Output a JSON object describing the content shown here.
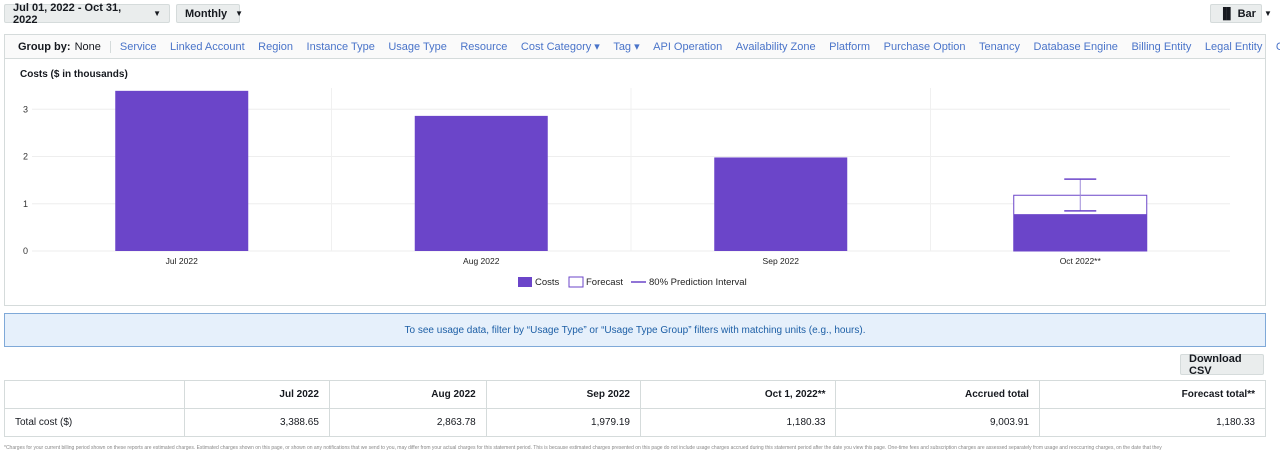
{
  "toolbar": {
    "date_range": "Jul 01, 2022 - Oct 31, 2022",
    "granularity": "Monthly",
    "chart_type": "Bar"
  },
  "group_by": {
    "label": "Group by:",
    "selected": "None",
    "options": [
      "Service",
      "Linked Account",
      "Region",
      "Instance Type",
      "Usage Type",
      "Resource",
      "Cost Category ▾",
      "Tag ▾",
      "API Operation",
      "Availability Zone",
      "Platform",
      "Purchase Option",
      "Tenancy",
      "Database Engine",
      "Billing Entity",
      "Legal Entity",
      "Charge Type"
    ]
  },
  "chart_data": {
    "type": "bar",
    "title": "Costs ($ in thousands)",
    "xlabel": "",
    "ylabel": "",
    "categories": [
      "Jul 2022",
      "Aug 2022",
      "Sep 2022",
      "Oct 2022**"
    ],
    "yticks": [
      0,
      1,
      2,
      3
    ],
    "ylim": [
      0,
      3.45
    ],
    "grid": true,
    "legend_position": "bottom",
    "series": [
      {
        "name": "Costs",
        "values": [
          3.39,
          2.86,
          1.98,
          0.78
        ],
        "color": "#6b45c9"
      },
      {
        "name": "Forecast",
        "values": [
          null,
          null,
          null,
          1.18
        ],
        "color": "#ffffff",
        "stroke": "#6b45c9"
      }
    ],
    "prediction_interval": {
      "name": "80% Prediction Interval",
      "category": "Oct 2022**",
      "low": 0.85,
      "high": 1.52,
      "color": "#6b45c9"
    }
  },
  "banner": "To see usage data, filter by “Usage Type” or “Usage Type Group” filters with matching units (e.g., hours).",
  "download_label": "Download CSV",
  "table": {
    "headers": [
      "",
      "Jul 2022",
      "Aug 2022",
      "Sep 2022",
      "Oct 1, 2022**",
      "Accrued total",
      "Forecast total**"
    ],
    "rows": [
      [
        "Total cost ($)",
        "3,388.65",
        "2,863.78",
        "1,979.19",
        "1,180.33",
        "9,003.91",
        "1,180.33"
      ]
    ]
  },
  "footnote": "*Charges for your current billing period shown on these reports are estimated charges. Estimated charges shown on this page, or shown on any notifications that we send to you, may differ from your actual charges for this statement period. This is because estimated charges presented on this page do not include usage charges accrued during this statement period after the date you view this page. One-time fees and subscription charges are assessed separately from usage and reoccurring charges, on the date that they"
}
